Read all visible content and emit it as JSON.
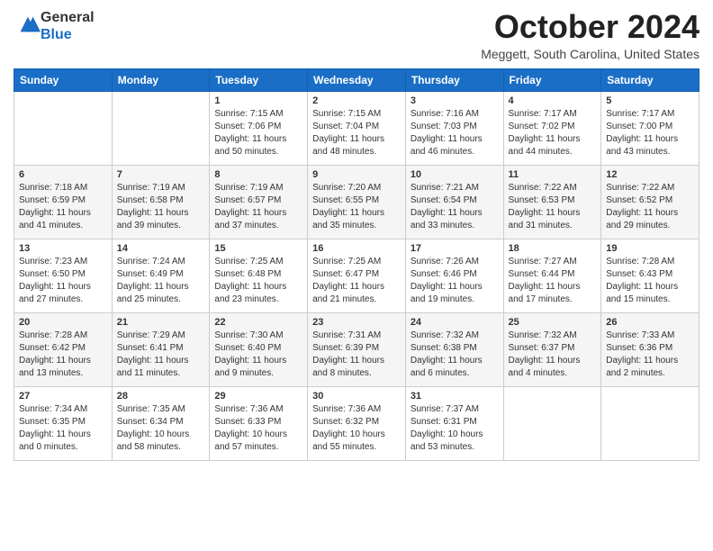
{
  "header": {
    "logo_general": "General",
    "logo_blue": "Blue",
    "month_title": "October 2024",
    "subtitle": "Meggett, South Carolina, United States"
  },
  "days_of_week": [
    "Sunday",
    "Monday",
    "Tuesday",
    "Wednesday",
    "Thursday",
    "Friday",
    "Saturday"
  ],
  "weeks": [
    [
      {
        "day": "",
        "sunrise": "",
        "sunset": "",
        "daylight": ""
      },
      {
        "day": "",
        "sunrise": "",
        "sunset": "",
        "daylight": ""
      },
      {
        "day": "1",
        "sunrise": "Sunrise: 7:15 AM",
        "sunset": "Sunset: 7:06 PM",
        "daylight": "Daylight: 11 hours and 50 minutes."
      },
      {
        "day": "2",
        "sunrise": "Sunrise: 7:15 AM",
        "sunset": "Sunset: 7:04 PM",
        "daylight": "Daylight: 11 hours and 48 minutes."
      },
      {
        "day": "3",
        "sunrise": "Sunrise: 7:16 AM",
        "sunset": "Sunset: 7:03 PM",
        "daylight": "Daylight: 11 hours and 46 minutes."
      },
      {
        "day": "4",
        "sunrise": "Sunrise: 7:17 AM",
        "sunset": "Sunset: 7:02 PM",
        "daylight": "Daylight: 11 hours and 44 minutes."
      },
      {
        "day": "5",
        "sunrise": "Sunrise: 7:17 AM",
        "sunset": "Sunset: 7:00 PM",
        "daylight": "Daylight: 11 hours and 43 minutes."
      }
    ],
    [
      {
        "day": "6",
        "sunrise": "Sunrise: 7:18 AM",
        "sunset": "Sunset: 6:59 PM",
        "daylight": "Daylight: 11 hours and 41 minutes."
      },
      {
        "day": "7",
        "sunrise": "Sunrise: 7:19 AM",
        "sunset": "Sunset: 6:58 PM",
        "daylight": "Daylight: 11 hours and 39 minutes."
      },
      {
        "day": "8",
        "sunrise": "Sunrise: 7:19 AM",
        "sunset": "Sunset: 6:57 PM",
        "daylight": "Daylight: 11 hours and 37 minutes."
      },
      {
        "day": "9",
        "sunrise": "Sunrise: 7:20 AM",
        "sunset": "Sunset: 6:55 PM",
        "daylight": "Daylight: 11 hours and 35 minutes."
      },
      {
        "day": "10",
        "sunrise": "Sunrise: 7:21 AM",
        "sunset": "Sunset: 6:54 PM",
        "daylight": "Daylight: 11 hours and 33 minutes."
      },
      {
        "day": "11",
        "sunrise": "Sunrise: 7:22 AM",
        "sunset": "Sunset: 6:53 PM",
        "daylight": "Daylight: 11 hours and 31 minutes."
      },
      {
        "day": "12",
        "sunrise": "Sunrise: 7:22 AM",
        "sunset": "Sunset: 6:52 PM",
        "daylight": "Daylight: 11 hours and 29 minutes."
      }
    ],
    [
      {
        "day": "13",
        "sunrise": "Sunrise: 7:23 AM",
        "sunset": "Sunset: 6:50 PM",
        "daylight": "Daylight: 11 hours and 27 minutes."
      },
      {
        "day": "14",
        "sunrise": "Sunrise: 7:24 AM",
        "sunset": "Sunset: 6:49 PM",
        "daylight": "Daylight: 11 hours and 25 minutes."
      },
      {
        "day": "15",
        "sunrise": "Sunrise: 7:25 AM",
        "sunset": "Sunset: 6:48 PM",
        "daylight": "Daylight: 11 hours and 23 minutes."
      },
      {
        "day": "16",
        "sunrise": "Sunrise: 7:25 AM",
        "sunset": "Sunset: 6:47 PM",
        "daylight": "Daylight: 11 hours and 21 minutes."
      },
      {
        "day": "17",
        "sunrise": "Sunrise: 7:26 AM",
        "sunset": "Sunset: 6:46 PM",
        "daylight": "Daylight: 11 hours and 19 minutes."
      },
      {
        "day": "18",
        "sunrise": "Sunrise: 7:27 AM",
        "sunset": "Sunset: 6:44 PM",
        "daylight": "Daylight: 11 hours and 17 minutes."
      },
      {
        "day": "19",
        "sunrise": "Sunrise: 7:28 AM",
        "sunset": "Sunset: 6:43 PM",
        "daylight": "Daylight: 11 hours and 15 minutes."
      }
    ],
    [
      {
        "day": "20",
        "sunrise": "Sunrise: 7:28 AM",
        "sunset": "Sunset: 6:42 PM",
        "daylight": "Daylight: 11 hours and 13 minutes."
      },
      {
        "day": "21",
        "sunrise": "Sunrise: 7:29 AM",
        "sunset": "Sunset: 6:41 PM",
        "daylight": "Daylight: 11 hours and 11 minutes."
      },
      {
        "day": "22",
        "sunrise": "Sunrise: 7:30 AM",
        "sunset": "Sunset: 6:40 PM",
        "daylight": "Daylight: 11 hours and 9 minutes."
      },
      {
        "day": "23",
        "sunrise": "Sunrise: 7:31 AM",
        "sunset": "Sunset: 6:39 PM",
        "daylight": "Daylight: 11 hours and 8 minutes."
      },
      {
        "day": "24",
        "sunrise": "Sunrise: 7:32 AM",
        "sunset": "Sunset: 6:38 PM",
        "daylight": "Daylight: 11 hours and 6 minutes."
      },
      {
        "day": "25",
        "sunrise": "Sunrise: 7:32 AM",
        "sunset": "Sunset: 6:37 PM",
        "daylight": "Daylight: 11 hours and 4 minutes."
      },
      {
        "day": "26",
        "sunrise": "Sunrise: 7:33 AM",
        "sunset": "Sunset: 6:36 PM",
        "daylight": "Daylight: 11 hours and 2 minutes."
      }
    ],
    [
      {
        "day": "27",
        "sunrise": "Sunrise: 7:34 AM",
        "sunset": "Sunset: 6:35 PM",
        "daylight": "Daylight: 11 hours and 0 minutes."
      },
      {
        "day": "28",
        "sunrise": "Sunrise: 7:35 AM",
        "sunset": "Sunset: 6:34 PM",
        "daylight": "Daylight: 10 hours and 58 minutes."
      },
      {
        "day": "29",
        "sunrise": "Sunrise: 7:36 AM",
        "sunset": "Sunset: 6:33 PM",
        "daylight": "Daylight: 10 hours and 57 minutes."
      },
      {
        "day": "30",
        "sunrise": "Sunrise: 7:36 AM",
        "sunset": "Sunset: 6:32 PM",
        "daylight": "Daylight: 10 hours and 55 minutes."
      },
      {
        "day": "31",
        "sunrise": "Sunrise: 7:37 AM",
        "sunset": "Sunset: 6:31 PM",
        "daylight": "Daylight: 10 hours and 53 minutes."
      },
      {
        "day": "",
        "sunrise": "",
        "sunset": "",
        "daylight": ""
      },
      {
        "day": "",
        "sunrise": "",
        "sunset": "",
        "daylight": ""
      }
    ]
  ]
}
